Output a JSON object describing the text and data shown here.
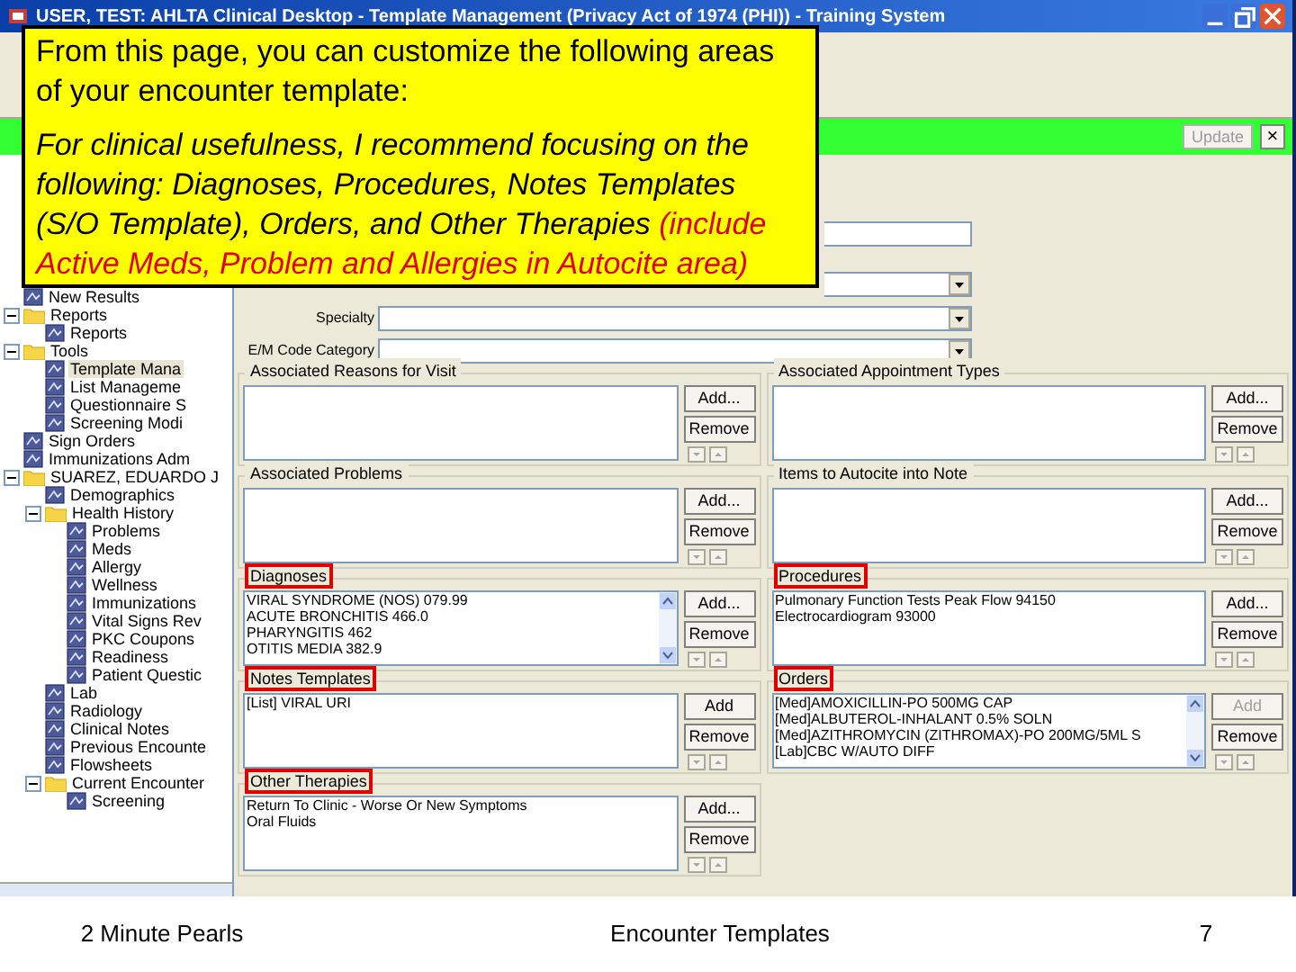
{
  "window": {
    "title": "USER, TEST: AHLTA Clinical Desktop - Template Management (Privacy Act of 1974 (PHI)) - Training System"
  },
  "callout": {
    "intro": "From this page, you can customize the following areas of your encounter template:",
    "recommendation": "For clinical usefulness, I recommend focusing on the following: Diagnoses, Procedures, Notes Templates (S/O Template), Orders, and Other Therapies",
    "recommendation_note": "(include Active Meds, Problem and Allergies in Autocite area)"
  },
  "action_bar": {
    "button": "Update",
    "close": "×"
  },
  "tree": [
    {
      "label": "New Results",
      "kind": "item",
      "selected": false
    },
    {
      "label": "Reports",
      "kind": "folder",
      "expanded": true,
      "selected": false,
      "children": [
        {
          "label": "Reports",
          "kind": "item",
          "selected": false
        }
      ]
    },
    {
      "label": "Tools",
      "kind": "folder",
      "expanded": true,
      "selected": false,
      "children": [
        {
          "label": "Template Mana",
          "kind": "item",
          "selected": true
        },
        {
          "label": "List Manageme",
          "kind": "item",
          "selected": false
        },
        {
          "label": "Questionnaire S",
          "kind": "item",
          "selected": false
        },
        {
          "label": "Screening Modi",
          "kind": "item",
          "selected": false
        }
      ]
    },
    {
      "label": "Sign Orders",
      "kind": "item",
      "selected": false
    },
    {
      "label": "Immunizations Adm",
      "kind": "item",
      "selected": false
    },
    {
      "label": "SUAREZ, EDUARDO J",
      "kind": "folder",
      "expanded": true,
      "selected": false,
      "children": [
        {
          "label": "Demographics",
          "kind": "item",
          "selected": false
        },
        {
          "label": "Health History",
          "kind": "folder",
          "expanded": true,
          "selected": false,
          "children": [
            {
              "label": "Problems",
              "kind": "item",
              "selected": false
            },
            {
              "label": "Meds",
              "kind": "item",
              "selected": false
            },
            {
              "label": "Allergy",
              "kind": "item",
              "selected": false
            },
            {
              "label": "Wellness",
              "kind": "item",
              "selected": false
            },
            {
              "label": "Immunizations",
              "kind": "item",
              "selected": false
            },
            {
              "label": "Vital Signs Rev",
              "kind": "item",
              "selected": false
            },
            {
              "label": "PKC Coupons",
              "kind": "item",
              "selected": false
            },
            {
              "label": "Readiness",
              "kind": "item",
              "selected": false
            },
            {
              "label": "Patient Questic",
              "kind": "item",
              "selected": false
            }
          ]
        },
        {
          "label": "Lab",
          "kind": "item",
          "selected": false
        },
        {
          "label": "Radiology",
          "kind": "item",
          "selected": false
        },
        {
          "label": "Clinical Notes",
          "kind": "item",
          "selected": false
        },
        {
          "label": "Previous Encounte",
          "kind": "item",
          "selected": false
        },
        {
          "label": "Flowsheets",
          "kind": "item",
          "selected": false
        },
        {
          "label": "Current Encounter",
          "kind": "folder",
          "expanded": true,
          "selected": false,
          "children": [
            {
              "label": "Screening",
              "kind": "item",
              "selected": false
            }
          ]
        }
      ]
    }
  ],
  "fields": [
    {
      "dropdown": false
    },
    {
      "dropdown": true
    },
    {
      "label": "Specialty",
      "dropdown": true
    },
    {
      "label": "E/M Code Category",
      "dropdown": true
    }
  ],
  "groups": [
    {
      "title": "Associated Reasons for Visit",
      "highlighted": false,
      "add": "Add...",
      "remove": "Remove",
      "add_disabled": false,
      "scrollbar": false
    },
    {
      "title": "Associated Appointment Types",
      "highlighted": false,
      "add": "Add...",
      "remove": "Remove",
      "add_disabled": false,
      "scrollbar": false
    },
    {
      "title": "Associated Problems",
      "highlighted": false,
      "add": "Add...",
      "remove": "Remove",
      "add_disabled": false,
      "scrollbar": false
    },
    {
      "title": "Items to Autocite into Note",
      "highlighted": false,
      "add": "Add...",
      "remove": "Remove",
      "add_disabled": false,
      "scrollbar": false
    },
    {
      "title": "Diagnoses",
      "highlighted": true,
      "items": [
        "VIRAL SYNDROME (NOS) 079.99",
        "ACUTE BRONCHITIS 466.0",
        "PHARYNGITIS 462",
        "OTITIS MEDIA 382.9"
      ],
      "add": "Add...",
      "remove": "Remove",
      "add_disabled": false,
      "scrollbar": true
    },
    {
      "title": "Procedures",
      "highlighted": true,
      "items": [
        "Pulmonary Function Tests Peak Flow 94150",
        "Electrocardiogram 93000"
      ],
      "add": "Add...",
      "remove": "Remove",
      "add_disabled": false,
      "scrollbar": false
    },
    {
      "title": "Notes Templates",
      "highlighted": true,
      "items": [
        "[List] VIRAL URI"
      ],
      "add": "Add",
      "remove": "Remove",
      "add_disabled": false,
      "scrollbar": false
    },
    {
      "title": "Orders",
      "highlighted": true,
      "items": [
        "[Med]AMOXICILLIN-PO 500MG CAP",
        "[Med]ALBUTEROL-INHALANT 0.5% SOLN",
        "[Med]AZITHROMYCIN (ZITHROMAX)-PO 200MG/5ML S",
        "[Lab]CBC W/AUTO DIFF"
      ],
      "add": "Add",
      "remove": "Remove",
      "add_disabled": true,
      "scrollbar": true
    },
    {
      "title": "Other Therapies",
      "highlighted": true,
      "items": [
        "Return To Clinic - Worse Or New Symptoms",
        "Oral Fluids"
      ],
      "add": "Add...",
      "remove": "Remove",
      "add_disabled": false,
      "scrollbar": false
    }
  ],
  "footer": {
    "left": "2 Minute Pearls",
    "center": "Encounter Templates",
    "page": "7"
  }
}
